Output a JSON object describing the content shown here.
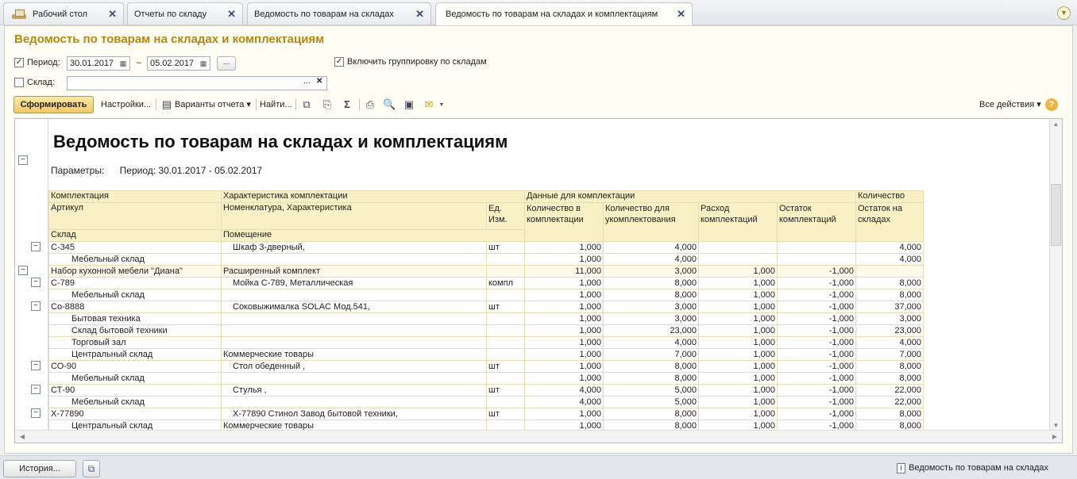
{
  "tabs": [
    {
      "label": "Рабочий стол"
    },
    {
      "label": "Отчеты по складу"
    },
    {
      "label": "Ведомость по товарам на складах"
    },
    {
      "label": "Ведомость по товарам на складах и комплектациям"
    }
  ],
  "form": {
    "title": "Ведомость по товарам на складах и комплектациям",
    "period_label": "Период:",
    "period_from": "30.01.2017",
    "period_dash": "–",
    "period_to": "05.02.2017",
    "period_select": "...",
    "group_label": "Включить группировку по складам",
    "warehouse_label": "Склад:",
    "warehouse_value": "",
    "warehouse_select": "...",
    "warehouse_clear": "✕"
  },
  "toolbar": {
    "generate": "Сформировать",
    "settings": "Настройки...",
    "variants": "Варианты отчета",
    "find": "Найти...",
    "all_actions": "Все действия",
    "help": "?"
  },
  "report": {
    "title": "Ведомость по товарам на складах и комплектациям",
    "params_label": "Параметры:",
    "params_value": "Период: 30.01.2017 - 05.02.2017",
    "headers": {
      "row1": [
        "Комплектация",
        "Характеристика комплектации",
        "Данные для комплектации",
        "Количество"
      ],
      "row2": [
        "Артикул",
        "Номенклатура, Характеристика",
        "Ед. Изм.",
        "Количество в комплектации",
        "Количество для укомплектования",
        "Расход комплектаций",
        "Остаток комплектаций",
        "Остаток на складах"
      ],
      "row3": [
        "Склад",
        "Помещение"
      ]
    },
    "rows": [
      {
        "c1": "С-345",
        "c2": "Шкаф 3-дверный,",
        "unit": "шт",
        "q": "1,000",
        "qu": "4,000",
        "r": "",
        "o": "",
        "s": "4,000",
        "type": "item"
      },
      {
        "c1": "Мебельный склад",
        "c2": "",
        "unit": "",
        "q": "1,000",
        "qu": "4,000",
        "r": "",
        "o": "",
        "s": "4,000",
        "type": "wh"
      },
      {
        "c1": "Набор кухонной мебели \"Диана\"",
        "c2": "Расширенный комплект",
        "unit": "",
        "q": "11,000",
        "qu": "3,000",
        "r": "1,000",
        "o": "-1,000",
        "s": "",
        "type": "grp"
      },
      {
        "c1": "С-789",
        "c2": "Мойка С-789, Металлическая",
        "unit": "компл",
        "q": "1,000",
        "qu": "8,000",
        "r": "1,000",
        "o": "-1,000",
        "s": "8,000",
        "type": "item"
      },
      {
        "c1": "Мебельный склад",
        "c2": "",
        "unit": "",
        "q": "1,000",
        "qu": "8,000",
        "r": "1,000",
        "o": "-1,000",
        "s": "8,000",
        "type": "wh"
      },
      {
        "c1": "Со-8888",
        "c2": "Соковыжималка  SOLAC  Мод.541,",
        "unit": "шт",
        "q": "1,000",
        "qu": "3,000",
        "r": "1,000",
        "o": "-1,000",
        "s": "37,000",
        "type": "item"
      },
      {
        "c1": "Бытовая техника",
        "c2": "",
        "unit": "",
        "q": "1,000",
        "qu": "3,000",
        "r": "1,000",
        "o": "-1,000",
        "s": "3,000",
        "type": "wh"
      },
      {
        "c1": "Склад бытовой техники",
        "c2": "",
        "unit": "",
        "q": "1,000",
        "qu": "23,000",
        "r": "1,000",
        "o": "-1,000",
        "s": "23,000",
        "type": "wh"
      },
      {
        "c1": "Торговый зал",
        "c2": "",
        "unit": "",
        "q": "1,000",
        "qu": "4,000",
        "r": "1,000",
        "o": "-1,000",
        "s": "4,000",
        "type": "wh"
      },
      {
        "c1": "Центральный склад",
        "c2": "Коммерческие товары",
        "unit": "",
        "q": "1,000",
        "qu": "7,000",
        "r": "1,000",
        "o": "-1,000",
        "s": "7,000",
        "type": "wh"
      },
      {
        "c1": "СО-90",
        "c2": "Стол обеденный ,",
        "unit": "шт",
        "q": "1,000",
        "qu": "8,000",
        "r": "1,000",
        "o": "-1,000",
        "s": "8,000",
        "type": "item"
      },
      {
        "c1": "Мебельный склад",
        "c2": "",
        "unit": "",
        "q": "1,000",
        "qu": "8,000",
        "r": "1,000",
        "o": "-1,000",
        "s": "8,000",
        "type": "wh"
      },
      {
        "c1": "СТ-90",
        "c2": "Стулья ,",
        "unit": "шт",
        "q": "4,000",
        "qu": "5,000",
        "r": "1,000",
        "o": "-1,000",
        "s": "22,000",
        "type": "item"
      },
      {
        "c1": "Мебельный склад",
        "c2": "",
        "unit": "",
        "q": "4,000",
        "qu": "5,000",
        "r": "1,000",
        "o": "-1,000",
        "s": "22,000",
        "type": "wh"
      },
      {
        "c1": "Х-77890",
        "c2": "Х-77890 Стинол Завод бытовой техники,",
        "unit": "шт",
        "q": "1,000",
        "qu": "8,000",
        "r": "1,000",
        "o": "-1,000",
        "s": "8,000",
        "type": "item"
      },
      {
        "c1": "Центральный склад",
        "c2": "Коммерческие товары",
        "unit": "",
        "q": "1,000",
        "qu": "8,000",
        "r": "1,000",
        "o": "-1,000",
        "s": "8,000",
        "type": "wh"
      }
    ]
  },
  "statusbar": {
    "history": "История...",
    "status_text": "Ведомость по товарам на складах"
  }
}
